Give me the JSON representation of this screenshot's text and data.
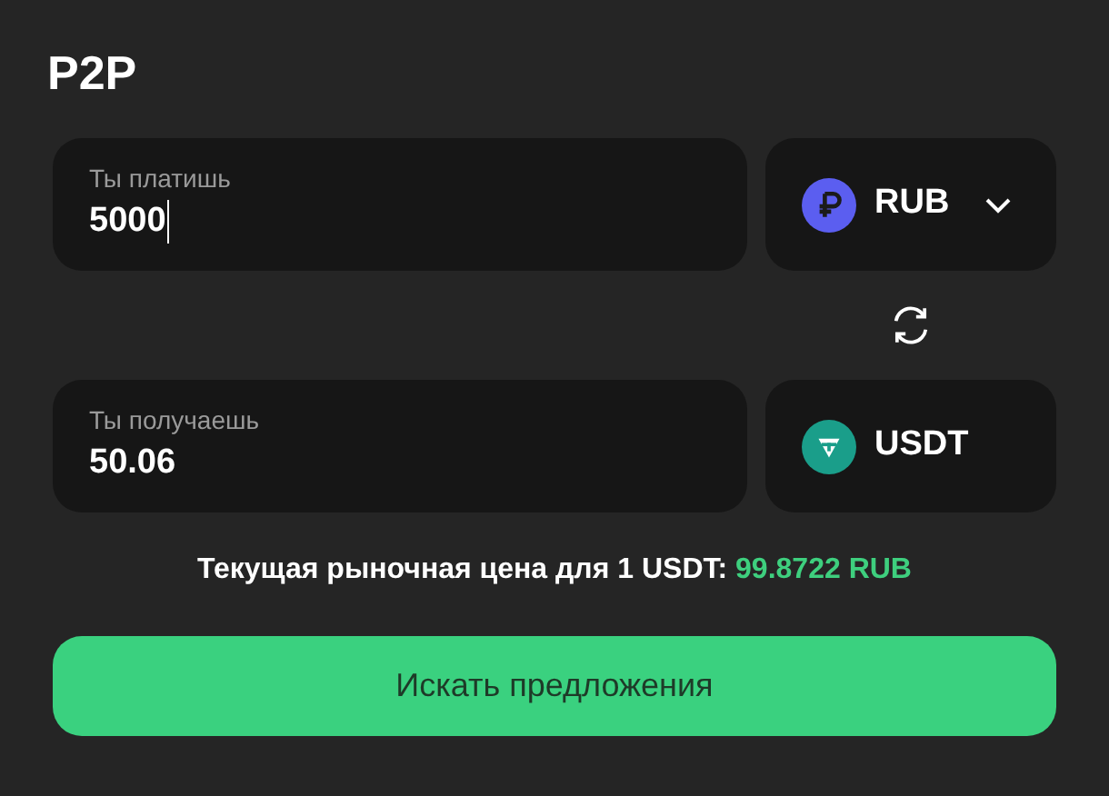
{
  "title": "P2P",
  "pay": {
    "label": "Ты платишь",
    "value": "5000",
    "focused": true,
    "currency": {
      "code": "RUB",
      "kind": "rub",
      "color": "#5b5ef0",
      "dropdown": true
    }
  },
  "receive": {
    "label": "Ты получаешь",
    "value": "50.06",
    "focused": false,
    "currency": {
      "code": "USDT",
      "kind": "usdt",
      "color": "#1a9e8a",
      "dropdown": false
    }
  },
  "price": {
    "label": "Текущая рыночная цена для 1 USDT:",
    "value": "99.8722 RUB"
  },
  "button": "Искать предложения"
}
